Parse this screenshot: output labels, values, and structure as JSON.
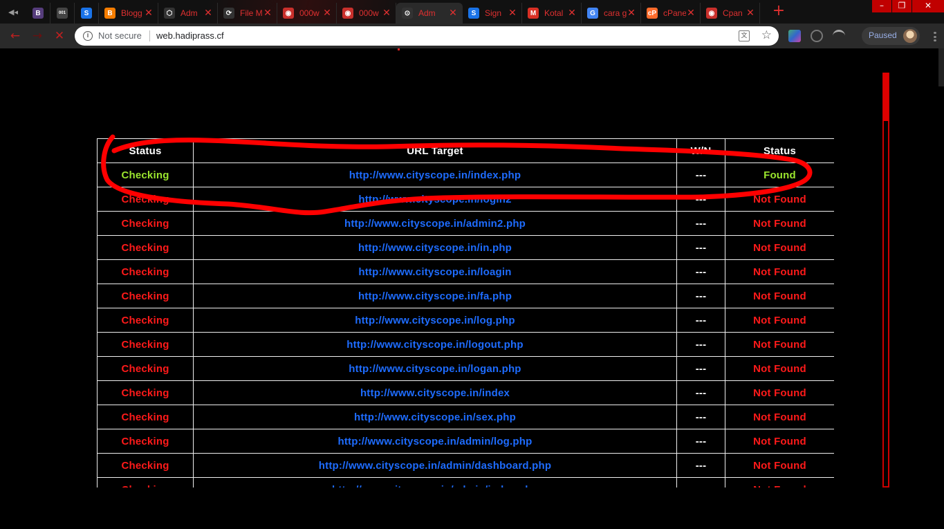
{
  "browser": {
    "tabs": [
      {
        "title": "",
        "favicon": "bootstrap-icon",
        "favicon_text": "B",
        "favicon_color": "#563d7c"
      },
      {
        "title": "",
        "favicon": "binary-site-icon",
        "favicon_text": "001",
        "favicon_color": "#444444"
      },
      {
        "title": "",
        "favicon": "shopify-icon",
        "favicon_text": "S",
        "favicon_color": "#1a73e8"
      },
      {
        "title": "Blogg",
        "favicon": "blogger-icon",
        "favicon_text": "B",
        "favicon_color": "#f57d00"
      },
      {
        "title": "Adm",
        "favicon": "hex-icon",
        "favicon_text": "⬡",
        "favicon_color": "#333333"
      },
      {
        "title": "File M",
        "favicon": "filemanager-icon",
        "favicon_text": "⟳",
        "favicon_color": "#333333"
      },
      {
        "title": "000w",
        "favicon": "webhost-icon",
        "favicon_text": "◉",
        "favicon_color": "#c9302c"
      },
      {
        "title": "000w",
        "favicon": "webhost-icon",
        "favicon_text": "◉",
        "favicon_color": "#c9302c"
      },
      {
        "title": "Adm",
        "favicon": "cpanel-icon",
        "favicon_text": "⊙",
        "favicon_color": "#333333",
        "active": true
      },
      {
        "title": "Sign",
        "favicon": "shopify-icon",
        "favicon_text": "S",
        "favicon_color": "#1a73e8"
      },
      {
        "title": "Kotal",
        "favicon": "gmail-icon",
        "favicon_text": "M",
        "favicon_color": "#d93025"
      },
      {
        "title": "cara g",
        "favicon": "google-icon",
        "favicon_text": "G",
        "favicon_color": "#4285f4"
      },
      {
        "title": "cPane",
        "favicon": "cpanel-icon",
        "favicon_text": "cP",
        "favicon_color": "#ff6c2c"
      },
      {
        "title": "Cpan",
        "favicon": "webhost-icon",
        "favicon_text": "◉",
        "favicon_color": "#c9302c"
      }
    ],
    "new_tab": "+",
    "window_controls": {
      "minimize": "–",
      "maximize": "❐",
      "close": "✕"
    },
    "nav": {
      "back": "←",
      "forward": "→",
      "stop": "✕"
    },
    "security_label": "Not secure",
    "url": "web.hadiprass.cf",
    "profile_label": "Paused"
  },
  "results": {
    "headers": {
      "status": "Status",
      "url": "URL Target",
      "wn": "W/N",
      "result": "Status"
    },
    "rows": [
      {
        "status": "Checking",
        "url": "http://www.cityscope.in/index.php",
        "wn": "---",
        "result": "Found",
        "found": true
      },
      {
        "status": "Checking",
        "url": "http://www.cityscope.in/login2",
        "wn": "---",
        "result": "Not Found",
        "found": false
      },
      {
        "status": "Checking",
        "url": "http://www.cityscope.in/admin2.php",
        "wn": "---",
        "result": "Not Found",
        "found": false
      },
      {
        "status": "Checking",
        "url": "http://www.cityscope.in/in.php",
        "wn": "---",
        "result": "Not Found",
        "found": false
      },
      {
        "status": "Checking",
        "url": "http://www.cityscope.in/loagin",
        "wn": "---",
        "result": "Not Found",
        "found": false
      },
      {
        "status": "Checking",
        "url": "http://www.cityscope.in/fa.php",
        "wn": "---",
        "result": "Not Found",
        "found": false
      },
      {
        "status": "Checking",
        "url": "http://www.cityscope.in/log.php",
        "wn": "---",
        "result": "Not Found",
        "found": false
      },
      {
        "status": "Checking",
        "url": "http://www.cityscope.in/logout.php",
        "wn": "---",
        "result": "Not Found",
        "found": false
      },
      {
        "status": "Checking",
        "url": "http://www.cityscope.in/logan.php",
        "wn": "---",
        "result": "Not Found",
        "found": false
      },
      {
        "status": "Checking",
        "url": "http://www.cityscope.in/index",
        "wn": "---",
        "result": "Not Found",
        "found": false
      },
      {
        "status": "Checking",
        "url": "http://www.cityscope.in/sex.php",
        "wn": "---",
        "result": "Not Found",
        "found": false
      },
      {
        "status": "Checking",
        "url": "http://www.cityscope.in/admin/log.php",
        "wn": "---",
        "result": "Not Found",
        "found": false
      },
      {
        "status": "Checking",
        "url": "http://www.cityscope.in/admin/dashboard.php",
        "wn": "---",
        "result": "Not Found",
        "found": false
      },
      {
        "status": "Checking",
        "url": "http://www.cityscope.in/admin/index.php",
        "wn": "---",
        "result": "Not Found",
        "found": false
      }
    ]
  },
  "colors": {
    "found": "#9be62e",
    "not_found": "#ff1a1a",
    "link": "#1e6cff",
    "accent": "#e00000"
  }
}
